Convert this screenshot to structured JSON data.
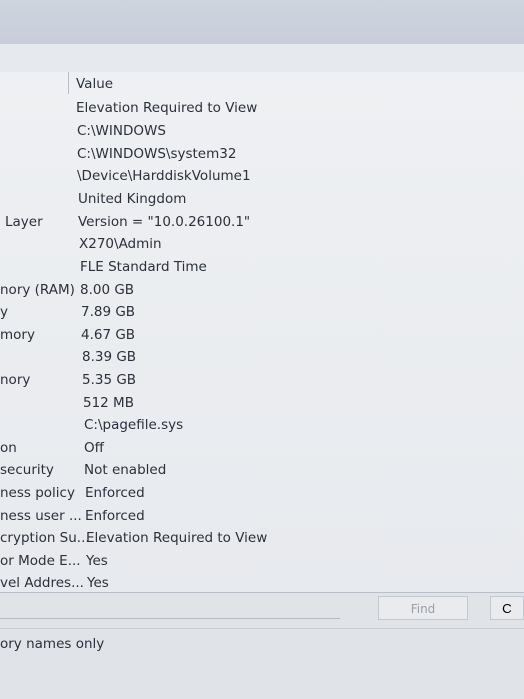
{
  "header": {
    "value_column": "Value"
  },
  "rows": [
    {
      "item": "",
      "value": "Elevation Required to View"
    },
    {
      "item": "",
      "value": "C:\\WINDOWS"
    },
    {
      "item": "",
      "value": "C:\\WINDOWS\\system32"
    },
    {
      "item": "",
      "value": "\\Device\\HarddiskVolume1"
    },
    {
      "item": "",
      "value": "United Kingdom"
    },
    {
      "item": "Layer",
      "value": "Version = \"10.0.26100.1\""
    },
    {
      "item": "",
      "value": "X270\\Admin"
    },
    {
      "item": "",
      "value": "FLE Standard Time"
    },
    {
      "item": "nory (RAM)",
      "value": "8.00 GB"
    },
    {
      "item": "y",
      "value": "7.89 GB"
    },
    {
      "item": "mory",
      "value": "4.67 GB"
    },
    {
      "item": "",
      "value": "8.39 GB"
    },
    {
      "item": "nory",
      "value": "5.35 GB"
    },
    {
      "item": "",
      "value": "512 MB"
    },
    {
      "item": "",
      "value": "C:\\pagefile.sys"
    },
    {
      "item": "on",
      "value": "Off"
    },
    {
      "item": "security",
      "value": "Not enabled"
    },
    {
      "item": "ness policy",
      "value": "Enforced"
    },
    {
      "item": "ness user ...",
      "value": "Enforced"
    },
    {
      "item": "cryption Su...",
      "value": "Elevation Required to View"
    },
    {
      "item": "or Mode E...",
      "value": "Yes"
    },
    {
      "item": "vel Addres...",
      "value": "Yes"
    }
  ],
  "find": {
    "button_label": "Find",
    "close_label": "C",
    "category_option": "ory names only"
  }
}
